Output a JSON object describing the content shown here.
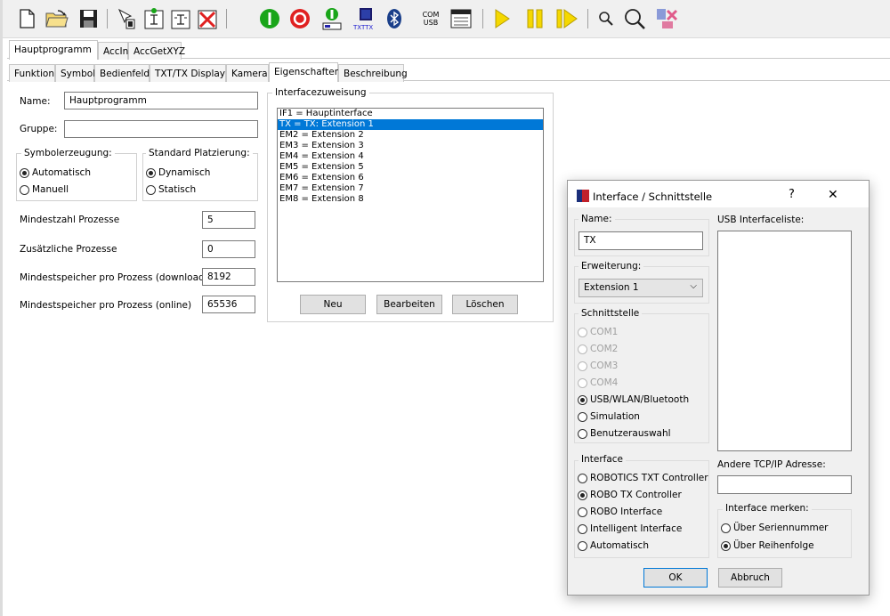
{
  "toolbar": {
    "icons": [
      "new-file-icon",
      "open-folder-icon",
      "save-disk-icon",
      "cursor-icon",
      "sub-program-icon",
      "program-module-icon",
      "delete-x-icon",
      "start-green-icon",
      "stop-red-icon",
      "online-ctrl-icon",
      "download-txt-icon",
      "bluetooth-icon",
      "com-usb-icon",
      "window-icon",
      "play-icon",
      "pause-icon",
      "step-icon",
      "zoom-small-icon",
      "zoom-large-icon",
      "debug-icon"
    ],
    "com_label": "COM",
    "usb_label": "USB",
    "txttx_label": "TXTTX"
  },
  "program_tabs": [
    "Hauptprogramm",
    "AccInit",
    "AccGetXYZ"
  ],
  "property_tabs": [
    "Funktion",
    "Symbol",
    "Bedienfeld",
    "TXT/TX Display",
    "Kamera",
    "Eigenschaften",
    "Beschreibung"
  ],
  "active_property_tab": "Eigenschaften",
  "form": {
    "name_label": "Name:",
    "name_value": "Hauptprogramm",
    "gruppe_label": "Gruppe:",
    "gruppe_value": "",
    "symbol_group_title": "Symbolerzeugung:",
    "symbol_options": [
      "Automatisch",
      "Manuell"
    ],
    "placement_group_title": "Standard Platzierung:",
    "placement_options": [
      "Dynamisch",
      "Statisch"
    ],
    "fields": [
      {
        "label": "Mindestzahl Prozesse",
        "value": "5"
      },
      {
        "label": "Zusätzliche Prozesse",
        "value": "0"
      },
      {
        "label": "Mindestspeicher pro Prozess (download)",
        "value": "8192"
      },
      {
        "label": "Mindestspeicher pro Prozess (online)",
        "value": "65536"
      }
    ]
  },
  "interface_assignment": {
    "title": "Interfacezuweisung",
    "items": [
      "IF1 = Hauptinterface",
      "TX = TX: Extension 1",
      "EM2 = Extension 2",
      "EM3 = Extension 3",
      "EM4 = Extension 4",
      "EM5 = Extension 5",
      "EM6 = Extension 6",
      "EM7 = Extension 7",
      "EM8 = Extension 8"
    ],
    "selected_index": 1,
    "buttons": {
      "new": "Neu",
      "edit": "Bearbeiten",
      "delete": "Löschen"
    }
  },
  "dialog": {
    "title": "Interface / Schnittstelle",
    "help": "?",
    "close": "✕",
    "name_label": "Name:",
    "name_value": "TX",
    "extension_label": "Erweiterung:",
    "extension_value": "Extension 1",
    "port_group_title": "Schnittstelle",
    "port_options": [
      {
        "label": "COM1",
        "enabled": false,
        "selected": false
      },
      {
        "label": "COM2",
        "enabled": false,
        "selected": false
      },
      {
        "label": "COM3",
        "enabled": false,
        "selected": false
      },
      {
        "label": "COM4",
        "enabled": false,
        "selected": false
      },
      {
        "label": "USB/WLAN/Bluetooth",
        "enabled": true,
        "selected": true
      },
      {
        "label": "Simulation",
        "enabled": true,
        "selected": false
      },
      {
        "label": "Benutzerauswahl",
        "enabled": true,
        "selected": false
      }
    ],
    "interface_group_title": "Interface",
    "interface_options": [
      {
        "label": "ROBOTICS TXT Controller",
        "selected": false
      },
      {
        "label": "ROBO TX Controller",
        "selected": true
      },
      {
        "label": "ROBO Interface",
        "selected": false
      },
      {
        "label": "Intelligent Interface",
        "selected": false
      },
      {
        "label": "Automatisch",
        "selected": false
      }
    ],
    "usb_list_label": "USB Interfaceliste:",
    "tcp_label": "Andere TCP/IP Adresse:",
    "tcp_value": "",
    "remember_group_title": "Interface merken:",
    "remember_options": [
      {
        "label": "Über Seriennummer",
        "selected": false
      },
      {
        "label": "Über Reihenfolge",
        "selected": true
      }
    ],
    "ok": "OK",
    "cancel": "Abbruch"
  },
  "colors": {
    "selection": "#0078d7",
    "accent_green": "#19a519",
    "accent_red": "#e02020",
    "accent_yellow": "#f5d800"
  }
}
